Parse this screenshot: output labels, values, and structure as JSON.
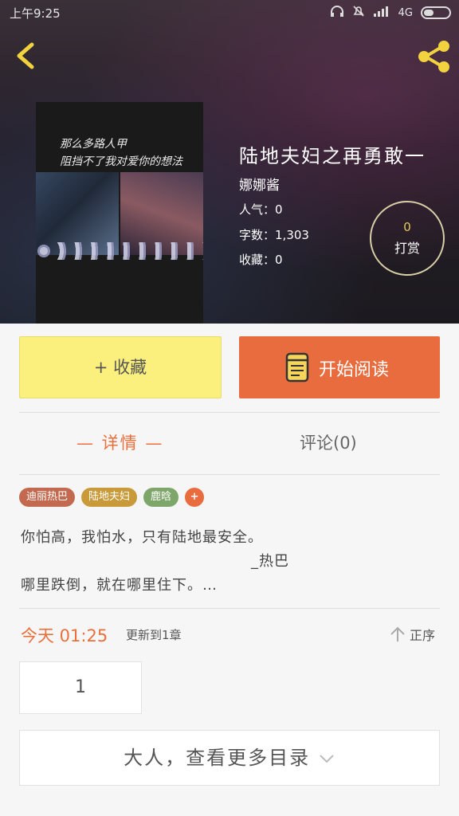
{
  "status_bar": {
    "time": "上午9:25",
    "network": "4G"
  },
  "book": {
    "title": "陆地夫妇之再勇敢一",
    "author": "娜娜酱",
    "popularity_label": "人气：",
    "popularity": "0",
    "word_count_label": "字数：",
    "word_count": "1,303",
    "favorites_label": "收藏：",
    "favorites": "0",
    "cover_script_line1": "那么多路人甲",
    "cover_script_line2": "阻挡不了我对爱你的想法"
  },
  "tip": {
    "count": "0",
    "label": "打赏"
  },
  "actions": {
    "collect_label": "+ 收藏",
    "read_label": "开始阅读"
  },
  "tabs": {
    "details": "— 详情 —",
    "comments": "评论(0)"
  },
  "tags": [
    {
      "label": "迪丽热巴",
      "color": "#c2694f"
    },
    {
      "label": "陆地夫妇",
      "color": "#c89a3a"
    },
    {
      "label": "鹿晗",
      "color": "#7fa66a"
    }
  ],
  "tag_add": "+",
  "description": {
    "line1": "你怕高，我怕水，只有陆地最安全。",
    "line2": "_热巴",
    "line3": "哪里跌倒，就在哪里住下。…"
  },
  "update": {
    "time": "今天 01:25",
    "text": "更新到1章",
    "sort_label": "正序"
  },
  "chapter": {
    "label": "1"
  },
  "more": {
    "label": "大人，查看更多目录"
  },
  "colors": {
    "accent": "#e96c3e",
    "collect": "#fbf07d"
  },
  "icons": [
    "back-icon",
    "share-icon",
    "book-icon",
    "sort-arrow-icon",
    "chevron-down-icon"
  ]
}
